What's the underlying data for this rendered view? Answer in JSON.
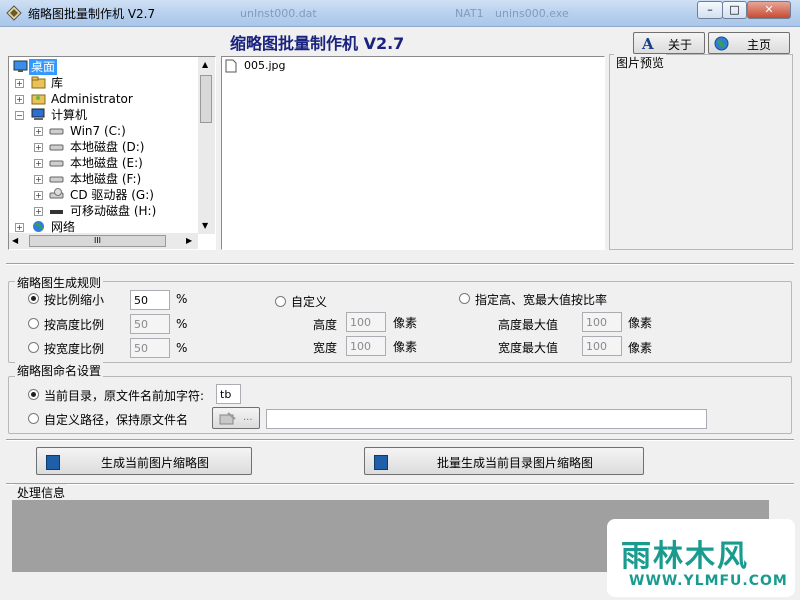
{
  "window": {
    "title": "缩略图批量制作机 V2.7",
    "ghost_tab_1": "unInst000.dat",
    "ghost_tab_2": "NAT1",
    "ghost_tab_3": "unins000.exe"
  },
  "header": {
    "title": "缩略图批量制作机  V2.7",
    "about_label": "关于",
    "home_label": "主页"
  },
  "tree": {
    "items": [
      {
        "label": "桌面"
      },
      {
        "label": "库"
      },
      {
        "label": "Administrator"
      },
      {
        "label": "计算机"
      },
      {
        "label": "Win7 (C:)"
      },
      {
        "label": "本地磁盘 (D:)"
      },
      {
        "label": "本地磁盘 (E:)"
      },
      {
        "label": "本地磁盘 (F:)"
      },
      {
        "label": "CD 驱动器 (G:)"
      },
      {
        "label": "可移动磁盘 (H:)"
      },
      {
        "label": "网络"
      }
    ],
    "hscroll_glyph": "III"
  },
  "files": [
    {
      "name": "005.jpg"
    }
  ],
  "preview": {
    "legend": "图片预览"
  },
  "rules": {
    "legend": "缩略图生成规则",
    "by_ratio": {
      "label": "按比例缩小",
      "value": "50",
      "unit": "%"
    },
    "by_height": {
      "label": "按高度比例",
      "value": "50",
      "unit": "%"
    },
    "by_width": {
      "label": "按宽度比例",
      "value": "50",
      "unit": "%"
    },
    "custom": {
      "label": "自定义",
      "height_label": "高度",
      "height_value": "100",
      "width_label": "宽度",
      "width_value": "100",
      "unit": "像素"
    },
    "max_ratio": {
      "label": "指定高、宽最大值按比率",
      "height_label": "高度最大值",
      "height_value": "100",
      "width_label": "宽度最大值",
      "width_value": "100",
      "unit": "像素"
    }
  },
  "naming": {
    "legend": "缩略图命名设置",
    "current_dir_label": "当前目录，原文件名前加字符:",
    "prefix_value": "tb",
    "custom_path_label": "自定义路径，保持原文件名",
    "browse_label": "...",
    "path_value": ""
  },
  "actions": {
    "generate_current": "生成当前图片缩略图",
    "generate_batch": "批量生成当前目录图片缩略图"
  },
  "log": {
    "legend": "处理信息"
  },
  "watermark": {
    "text": "雨林木风",
    "url": "WWW.YLMFU.COM"
  },
  "colors": {
    "title_accent": "#1a237e",
    "selection": "#3399ff",
    "log_bg": "#a0a0a0",
    "watermark": "#1a9b8f"
  }
}
